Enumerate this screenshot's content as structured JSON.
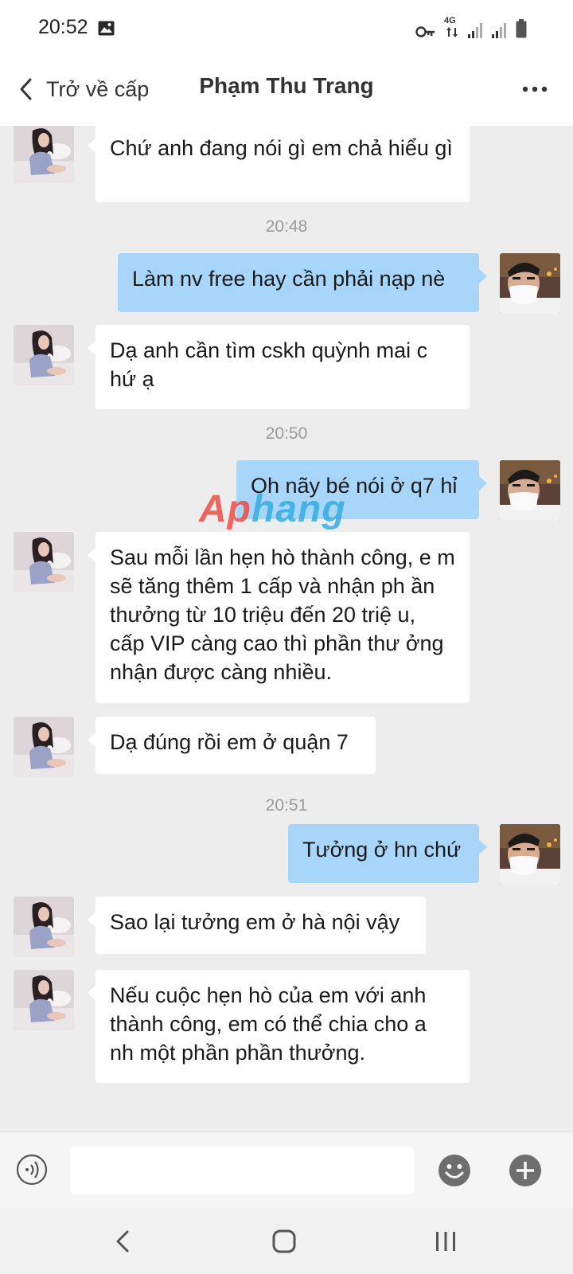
{
  "status": {
    "time": "20:52",
    "network": "4G",
    "icons": [
      "image-icon",
      "key-icon",
      "network-4g-icon",
      "signal-icon",
      "signal-icon",
      "battery-icon"
    ]
  },
  "header": {
    "back_label": "Trở về cấp",
    "title": "Phạm Thu Trang",
    "icons": [
      "chevron-left-icon",
      "more-icon"
    ]
  },
  "chat": {
    "messages": [
      {
        "dir": "in",
        "text": "Chứ anh đang nói gì em chả hiểu gì"
      },
      {
        "type": "time",
        "text": "20:48"
      },
      {
        "dir": "out",
        "text": "Làm nv free hay cần phải nạp nè"
      },
      {
        "dir": "in",
        "text": "Dạ anh cần tìm cskh quỳnh mai c hứ ạ"
      },
      {
        "type": "time",
        "text": "20:50"
      },
      {
        "dir": "out",
        "text": "Oh nãy bé nói ở q7 hỉ"
      },
      {
        "dir": "in",
        "text": "Sau mỗi lần hẹn hò thành công, e m sẽ tăng thêm 1 cấp và nhận ph ần thưởng từ 10 triệu đến 20 triệ u, cấp VIP càng cao thì phần thư ởng nhận được càng nhiều."
      },
      {
        "dir": "in",
        "text": "Dạ đúng rồi em ở quận 7"
      },
      {
        "type": "time",
        "text": "20:51"
      },
      {
        "dir": "out",
        "text": "Tưởng ở hn chứ"
      },
      {
        "dir": "in",
        "text": "Sao lại tưởng em ở hà nội vậy"
      },
      {
        "dir": "in",
        "text": "Nếu cuộc hẹn hò của em với anh thành công, em có thể chia cho a nh một phần phần thưởng."
      }
    ]
  },
  "watermark": {
    "part1": "Ap",
    "part2": "hang"
  },
  "input": {
    "placeholder": "",
    "value": "",
    "icons": [
      "voice-icon",
      "emoji-icon",
      "plus-icon"
    ]
  },
  "nav": {
    "icons": [
      "nav-back-icon",
      "nav-home-icon",
      "nav-recents-icon"
    ]
  },
  "colors": {
    "incoming_bubble": "#ffffff",
    "outgoing_bubble": "#a8d6fb",
    "chat_background": "#ededed"
  }
}
